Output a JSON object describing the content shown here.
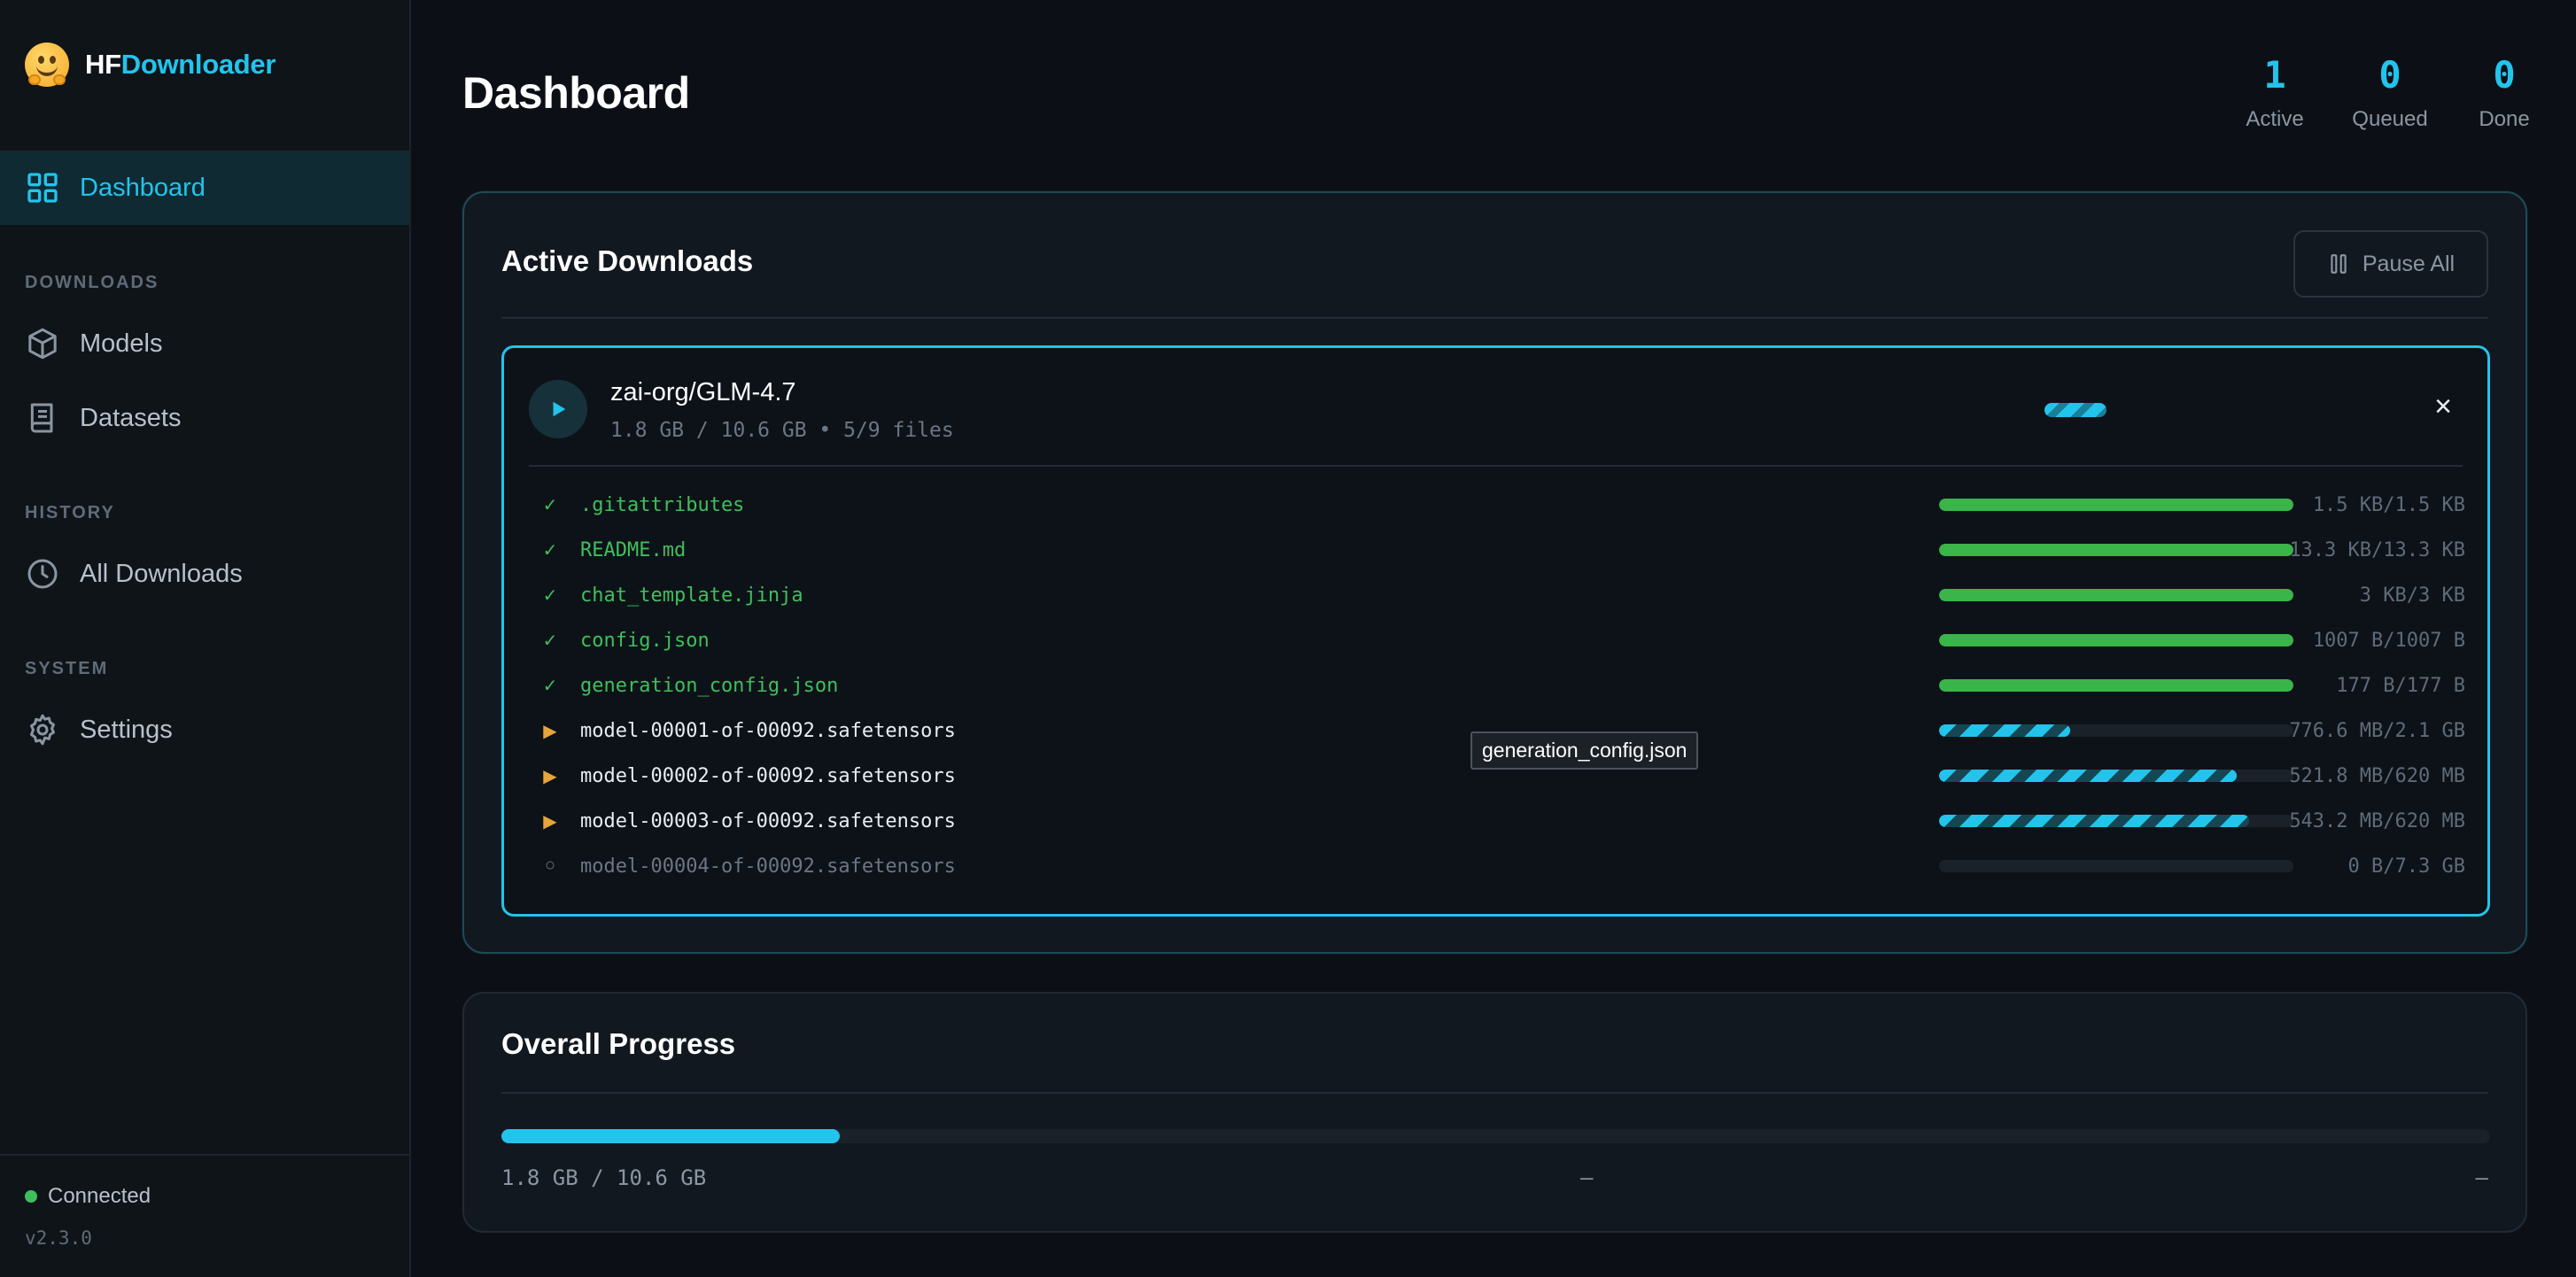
{
  "brand": {
    "prefix": "HF",
    "suffix": "Downloader",
    "logo_icon": "hugging-face-emoji-icon"
  },
  "sidebar": {
    "dashboard": "Dashboard",
    "sections": [
      {
        "title": "DOWNLOADS",
        "items": [
          "Models",
          "Datasets"
        ]
      },
      {
        "title": "HISTORY",
        "items": [
          "All Downloads"
        ]
      },
      {
        "title": "SYSTEM",
        "items": [
          "Settings"
        ]
      }
    ],
    "status": "Connected",
    "version": "v2.3.0"
  },
  "header": {
    "title": "Dashboard",
    "stats": [
      {
        "value": "1",
        "label": "Active"
      },
      {
        "value": "0",
        "label": "Queued"
      },
      {
        "value": "0",
        "label": "Done"
      }
    ]
  },
  "active": {
    "title": "Active Downloads",
    "pause_all": "Pause All",
    "repo": "zai-org/GLM-4.7",
    "meta": "1.8 GB / 10.6 GB • 5/9 files",
    "close": "×",
    "files": [
      {
        "icon": "✓",
        "name": ".gitattributes",
        "size": "1.5 KB/1.5 KB",
        "progress": 1.0,
        "state": "done"
      },
      {
        "icon": "✓",
        "name": "README.md",
        "size": "13.3 KB/13.3 KB",
        "progress": 1.0,
        "state": "done"
      },
      {
        "icon": "✓",
        "name": "chat_template.jinja",
        "size": "3 KB/3 KB",
        "progress": 1.0,
        "state": "done"
      },
      {
        "icon": "✓",
        "name": "config.json",
        "size": "1007 B/1007 B",
        "progress": 1.0,
        "state": "done"
      },
      {
        "icon": "✓",
        "name": "generation_config.json",
        "size": "177 B/177 B",
        "progress": 1.0,
        "state": "done"
      },
      {
        "icon": "▶",
        "name": "model-00001-of-00092.safetensors",
        "size": "776.6 MB/2.1 GB",
        "progress": 0.37,
        "state": "prog"
      },
      {
        "icon": "▶",
        "name": "model-00002-of-00092.safetensors",
        "size": "521.8 MB/620 MB",
        "progress": 0.84,
        "state": "prog"
      },
      {
        "icon": "▶",
        "name": "model-00003-of-00092.safetensors",
        "size": "543.2 MB/620 MB",
        "progress": 0.875,
        "state": "prog"
      },
      {
        "icon": "○",
        "name": "model-00004-of-00092.safetensors",
        "size": "0 B/7.3 GB",
        "progress": 0.0,
        "state": "wait"
      }
    ],
    "tooltip": "generation_config.json"
  },
  "overall": {
    "title": "Overall Progress",
    "progress": 0.17,
    "size": "1.8 GB / 10.6 GB",
    "speed": "–",
    "eta": "–"
  },
  "colors": {
    "accent": "#22c4ec",
    "success": "#3ab54a",
    "warning": "#e8a33a",
    "background": "#0c1016"
  }
}
